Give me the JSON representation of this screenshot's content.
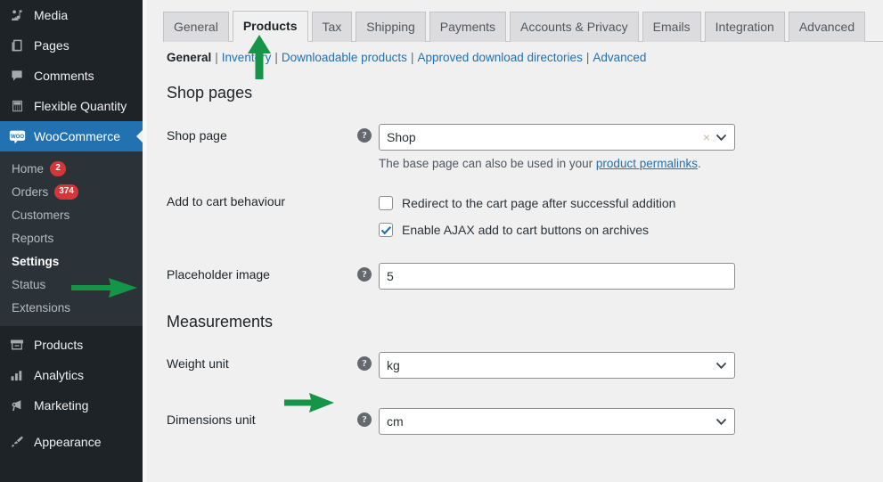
{
  "colors": {
    "sidebar_bg": "#1d2327",
    "submenu_bg": "#2c3338",
    "highlight": "#2271b1",
    "badge": "#d63638",
    "content_bg": "#f0f0f1",
    "link": "#2271b1",
    "arrow_green": "#159548"
  },
  "sidebar": {
    "items": [
      {
        "label": "Media",
        "icon": "media-icon"
      },
      {
        "label": "Pages",
        "icon": "pages-icon"
      },
      {
        "label": "Comments",
        "icon": "comments-icon"
      },
      {
        "label": "Flexible Quantity",
        "icon": "calculator-icon"
      },
      {
        "label": "WooCommerce",
        "icon": "woocommerce-icon",
        "current": true
      }
    ],
    "submenu": [
      {
        "label": "Home",
        "badge": "2"
      },
      {
        "label": "Orders",
        "badge": "374"
      },
      {
        "label": "Customers",
        "badge": ""
      },
      {
        "label": "Reports",
        "badge": ""
      },
      {
        "label": "Settings",
        "badge": "",
        "active": true
      },
      {
        "label": "Status",
        "badge": ""
      },
      {
        "label": "Extensions",
        "badge": ""
      }
    ],
    "items_bottom": [
      {
        "label": "Products",
        "icon": "products-icon"
      },
      {
        "label": "Analytics",
        "icon": "analytics-icon"
      },
      {
        "label": "Marketing",
        "icon": "marketing-icon"
      },
      {
        "label": "Appearance",
        "icon": "appearance-icon"
      }
    ]
  },
  "tabs": [
    {
      "label": "General"
    },
    {
      "label": "Products",
      "active": true
    },
    {
      "label": "Tax"
    },
    {
      "label": "Shipping"
    },
    {
      "label": "Payments"
    },
    {
      "label": "Accounts & Privacy"
    },
    {
      "label": "Emails"
    },
    {
      "label": "Integration"
    },
    {
      "label": "Advanced"
    }
  ],
  "subnav": [
    {
      "label": "General",
      "current": true
    },
    {
      "label": "Inventory"
    },
    {
      "label": "Downloadable products"
    },
    {
      "label": "Approved download directories"
    },
    {
      "label": "Advanced"
    }
  ],
  "sections": {
    "shop_pages_title": "Shop pages",
    "measurements_title": "Measurements"
  },
  "fields": {
    "shop_page": {
      "label": "Shop page",
      "value": "Shop",
      "help_icon": "help-icon",
      "clear_icon": "clear-icon",
      "chevron_icon": "chevron-down-icon",
      "helper_prefix": "The base page can also be used in your ",
      "helper_link": "product permalinks",
      "helper_suffix": "."
    },
    "add_to_cart": {
      "label": "Add to cart behaviour",
      "options": [
        {
          "label": "Redirect to the cart page after successful addition",
          "checked": false
        },
        {
          "label": "Enable AJAX add to cart buttons on archives",
          "checked": true
        }
      ]
    },
    "placeholder_image": {
      "label": "Placeholder image",
      "value": "5",
      "help_icon": "help-icon"
    },
    "weight_unit": {
      "label": "Weight unit",
      "value": "kg",
      "help_icon": "help-icon",
      "chevron_icon": "chevron-down-icon"
    },
    "dimensions_unit": {
      "label": "Dimensions unit",
      "value": "cm",
      "help_icon": "help-icon",
      "chevron_icon": "chevron-down-icon"
    }
  },
  "annotations": [
    {
      "name": "arrow-to-products-tab",
      "direction": "up"
    },
    {
      "name": "arrow-to-settings",
      "direction": "right"
    },
    {
      "name": "arrow-to-weight-unit",
      "direction": "right"
    }
  ]
}
